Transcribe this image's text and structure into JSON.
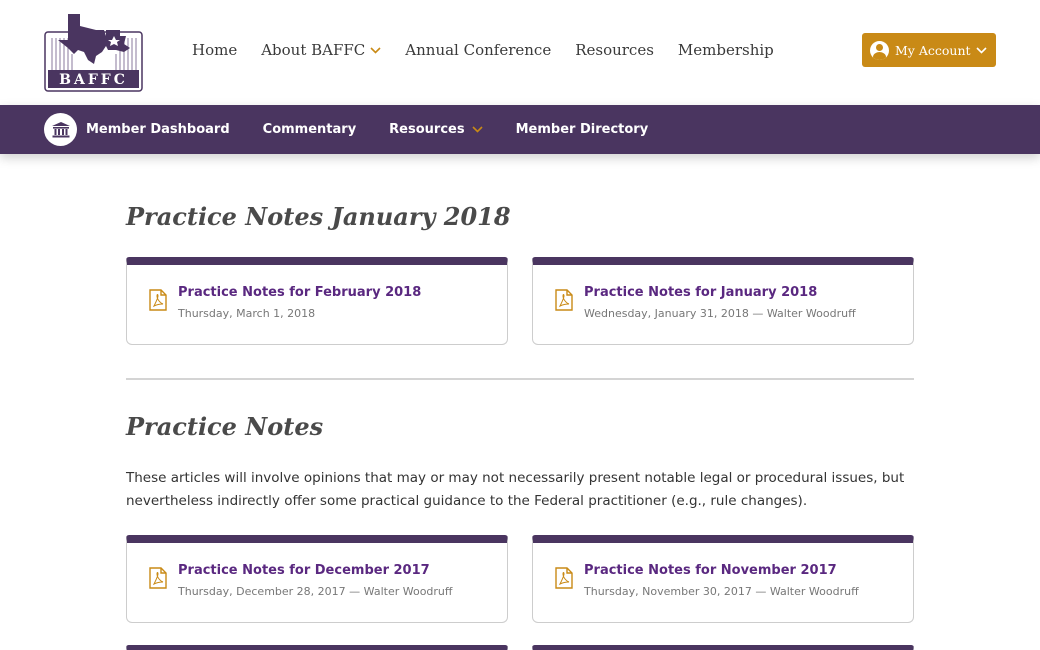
{
  "site": {
    "logo_text": "BAFFC"
  },
  "main_nav": {
    "items": [
      {
        "label": "Home"
      },
      {
        "label": "About BAFFC"
      },
      {
        "label": "Annual Conference"
      },
      {
        "label": "Resources"
      },
      {
        "label": "Membership"
      }
    ]
  },
  "account": {
    "label": "My Account"
  },
  "member_nav": {
    "items": [
      {
        "label": "Member Dashboard"
      },
      {
        "label": "Commentary"
      },
      {
        "label": "Resources"
      },
      {
        "label": "Member Directory"
      }
    ]
  },
  "featured": {
    "title": "Practice Notes January 2018",
    "cards": [
      {
        "title": "Practice Notes for February 2018",
        "meta": "Thursday, March 1, 2018"
      },
      {
        "title": "Practice Notes for January 2018",
        "meta": "Wednesday, January 31, 2018 — Walter Woodruff"
      }
    ]
  },
  "practice_notes": {
    "title": "Practice Notes",
    "intro": "These articles will involve opinions that may or may not necessarily present notable legal or procedural issues, but nevertheless indirectly offer some practical guidance to the Federal practitioner (e.g., rule changes).",
    "cards": [
      {
        "title": "Practice Notes for December 2017",
        "meta": "Thursday, December 28, 2017 — Walter Woodruff"
      },
      {
        "title": "Practice Notes for November 2017",
        "meta": "Thursday, November 30, 2017 — Walter Woodruff"
      }
    ]
  },
  "colors": {
    "brand_purple": "#4a3560",
    "link_purple": "#5a2880",
    "accent_gold": "#c98a16"
  }
}
